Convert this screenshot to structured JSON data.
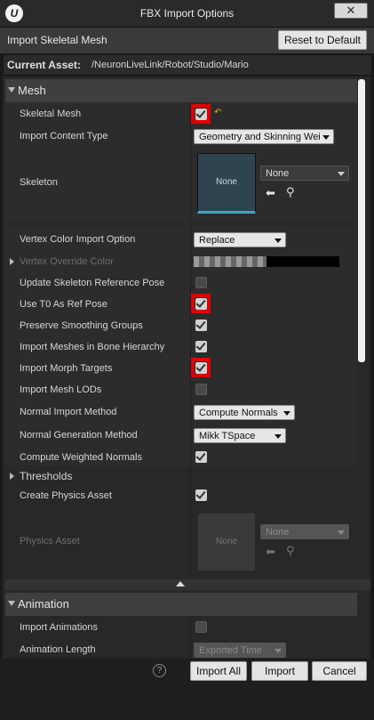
{
  "window": {
    "title": "FBX Import Options",
    "logo": "U",
    "close_glyph": "✕"
  },
  "header": {
    "label": "Import Skeletal Mesh",
    "reset_label": "Reset to Default"
  },
  "asset": {
    "label": "Current Asset:",
    "path": "/NeuronLiveLink/Robot/Studio/Mario"
  },
  "mesh": {
    "title": "Mesh",
    "skeletal_mesh": {
      "label": "Skeletal Mesh",
      "checked": true
    },
    "import_content_type": {
      "label": "Import Content Type",
      "value": "Geometry and Skinning Wei"
    },
    "skeleton": {
      "label": "Skeleton",
      "thumb_text": "None",
      "value": "None"
    },
    "vertex_color_import": {
      "label": "Vertex Color Import Option",
      "value": "Replace"
    },
    "vertex_override_color": {
      "label": "Vertex Override Color"
    },
    "update_skeleton_ref": {
      "label": "Update Skeleton Reference Pose",
      "checked": false
    },
    "use_t0": {
      "label": "Use T0 As Ref Pose",
      "checked": true
    },
    "preserve_smoothing": {
      "label": "Preserve Smoothing Groups",
      "checked": true
    },
    "import_bone_hierarchy": {
      "label": "Import Meshes in Bone Hierarchy",
      "checked": true
    },
    "import_morph": {
      "label": "Import Morph Targets",
      "checked": true
    },
    "import_lods": {
      "label": "Import Mesh LODs",
      "checked": false
    },
    "normal_import": {
      "label": "Normal Import Method",
      "value": "Compute Normals"
    },
    "normal_generation": {
      "label": "Normal Generation Method",
      "value": "Mikk TSpace"
    },
    "weighted_normals": {
      "label": "Compute Weighted Normals",
      "checked": true
    },
    "thresholds": {
      "label": "Thresholds"
    },
    "create_physics": {
      "label": "Create Physics Asset",
      "checked": true
    },
    "physics_asset": {
      "label": "Physics Asset",
      "thumb_text": "None",
      "value": "None"
    }
  },
  "animation": {
    "title": "Animation",
    "import_animations": {
      "label": "Import Animations",
      "checked": false
    },
    "animation_length": {
      "label": "Animation Length",
      "value": "Exported Time"
    }
  },
  "footer": {
    "help_glyph": "?",
    "import_all": "Import All",
    "import": "Import",
    "cancel": "Cancel"
  }
}
